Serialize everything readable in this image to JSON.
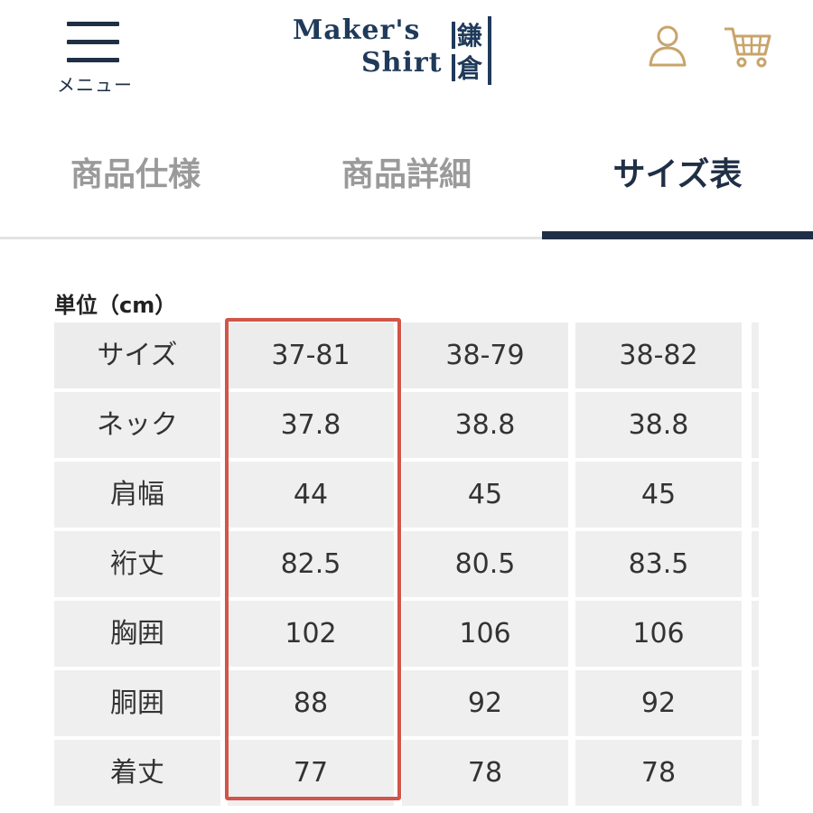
{
  "header": {
    "menu_label": "メニュー",
    "logo": {
      "line1": "Maker's",
      "line2": "Shirt",
      "kanji1": "鎌",
      "kanji2": "倉"
    },
    "icons": [
      "menu-icon",
      "user-icon",
      "cart-icon"
    ],
    "colors": {
      "brand": "#1f3a5a",
      "navy": "#1f2f46",
      "icon_gold": "#c8a46a"
    }
  },
  "tabs": [
    {
      "label": "商品仕様",
      "active": false
    },
    {
      "label": "商品詳細",
      "active": false
    },
    {
      "label": "サイズ表",
      "active": true
    }
  ],
  "size_table": {
    "unit_label": "単位（cm）",
    "header": [
      "サイズ",
      "37-81",
      "38-79",
      "38-82"
    ],
    "rows": [
      [
        "ネック",
        "37.8",
        "38.8",
        "38.8"
      ],
      [
        "肩幅",
        "44",
        "45",
        "45"
      ],
      [
        "裄丈",
        "82.5",
        "80.5",
        "83.5"
      ],
      [
        "胸囲",
        "102",
        "106",
        "106"
      ],
      [
        "胴囲",
        "88",
        "92",
        "92"
      ],
      [
        "着丈",
        "77",
        "78",
        "78"
      ]
    ],
    "highlighted_column": "37-81",
    "highlight_color": "#d2554a"
  }
}
